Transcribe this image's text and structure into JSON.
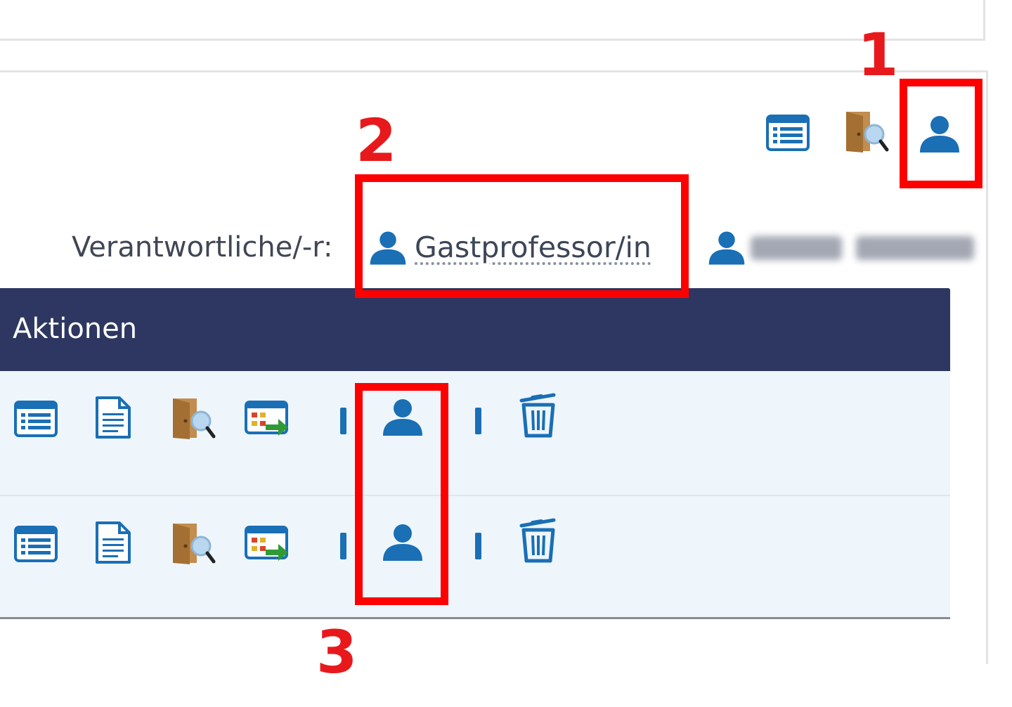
{
  "responsible": {
    "label": "Verantwortliche/-r:",
    "link_text": "Gastprofessor/in"
  },
  "actions_table": {
    "header": "Aktionen",
    "rows": [
      {
        "icons": [
          "details-icon",
          "document-icon",
          "room-search-icon",
          "export-icon",
          "person-icon",
          "trash-icon"
        ]
      },
      {
        "icons": [
          "details-icon",
          "document-icon",
          "room-search-icon",
          "export-icon",
          "person-icon",
          "trash-icon"
        ]
      }
    ]
  },
  "callouts": [
    "1",
    "2",
    "3"
  ],
  "colors": {
    "icon_blue": "#1a6fb5",
    "header_bg": "#2e3761",
    "row_bg": "#eef6fc",
    "callout_red": "#ff0000"
  }
}
